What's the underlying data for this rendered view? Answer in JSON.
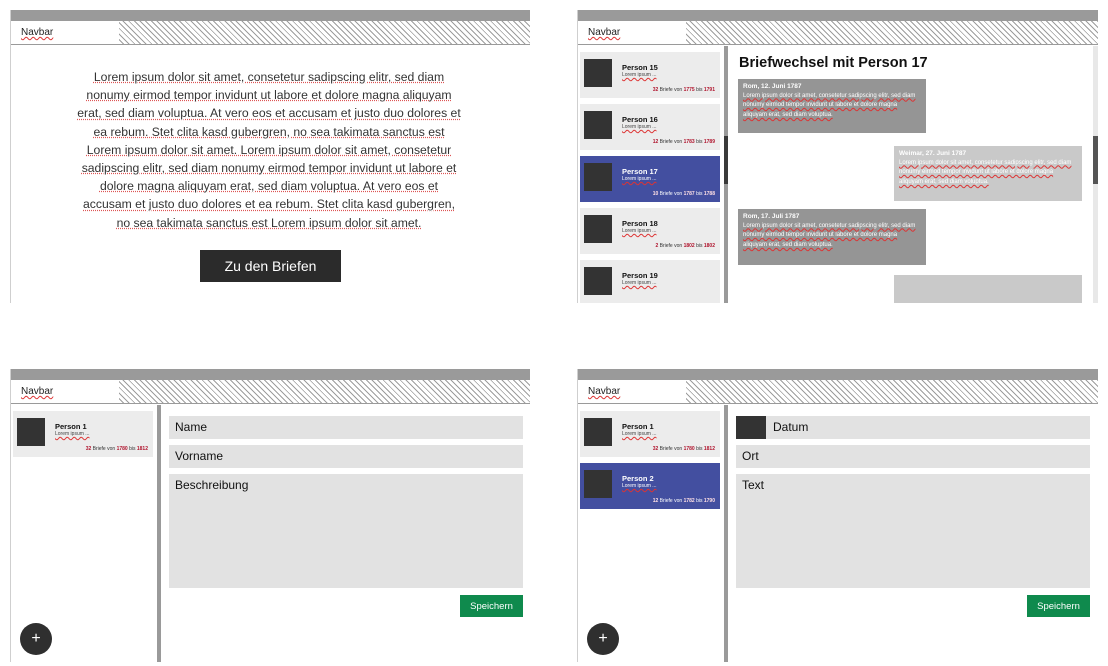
{
  "navbar": {
    "label": "Navbar"
  },
  "landing": {
    "text": "Lorem ipsum dolor sit amet, consetetur sadipscing elitr, sed diam nonumy eirmod tempor invidunt ut labore et dolore magna aliquyam erat, sed diam voluptua. At vero eos et accusam et justo duo dolores et ea rebum. Stet clita kasd gubergren, no sea takimata sanctus est Lorem ipsum dolor sit amet. Lorem ipsum dolor sit amet, consetetur sadipscing elitr, sed diam nonumy eirmod tempor invidunt ut labore et dolore magna aliquyam erat, sed diam voluptua. At vero eos et accusam et justo duo dolores et ea rebum. Stet clita kasd gubergren, no sea takimata sanctus est Lorem ipsum dolor sit amet.",
    "button_label": "Zu den Briefen"
  },
  "correspondence": {
    "persons": [
      {
        "name": "Person 15",
        "sub": "Lorem ipsum ...",
        "count": "32",
        "from": "1775",
        "to": "1791"
      },
      {
        "name": "Person 16",
        "sub": "Lorem ipsum ...",
        "count": "12",
        "from": "1783",
        "to": "1789"
      },
      {
        "name": "Person 17",
        "sub": "Lorem ipsum ...",
        "count": "10",
        "from": "1787",
        "to": "1788"
      },
      {
        "name": "Person 18",
        "sub": "Lorem ipsum ...",
        "count": "2",
        "from": "1802",
        "to": "1802"
      },
      {
        "name": "Person 19",
        "sub": "Lorem ipsum ..."
      }
    ],
    "title": "Briefwechsel mit Person 17",
    "letters": [
      {
        "head": "Rom, 12. Juni 1787",
        "body": "Lorem ipsum dolor sit amet, consetetur sadipscing elitr, sed diam nonumy eirmod tempor invidunt ut labore et dolore magna aliquyam erat, sed diam voluptua."
      },
      {
        "head": "Weimar, 27. Juni 1787",
        "body": "Lorem ipsum dolor sit amet, consetetur sadipscing elitr, sed diam nonumy eirmod tempor invidunt ut labore et dolore magna aliquyam erat, sed diam voluptua."
      },
      {
        "head": "Rom, 17. Juli 1787",
        "body": "Lorem ipsum dolor sit amet, consetetur sadipscing elitr, sed diam nonumy eirmod tempor invidunt ut labore et dolore magna aliquyam erat, sed diam voluptua."
      }
    ]
  },
  "person_form": {
    "persons": [
      {
        "name": "Person 1",
        "sub": "Lorem ipsum ...",
        "count": "32",
        "from": "1780",
        "to": "1812"
      }
    ],
    "field_name": "Name",
    "field_firstname": "Vorname",
    "field_description": "Beschreibung",
    "save_label": "Speichern",
    "add_label": "+"
  },
  "letter_form": {
    "persons": [
      {
        "name": "Person 1",
        "sub": "Lorem ipsum ...",
        "count": "32",
        "from": "1780",
        "to": "1812"
      },
      {
        "name": "Person 2",
        "sub": "Lorem ipsum ...",
        "count": "12",
        "from": "1782",
        "to": "1790"
      }
    ],
    "field_date": "Datum",
    "field_place": "Ort",
    "field_text": "Text",
    "save_label": "Speichern",
    "add_label": "+"
  },
  "labels": {
    "letters_from": "Briefe von",
    "until": "bis"
  },
  "colors": {
    "active_card": "#434fa0",
    "save_button": "#0f8a4d",
    "highlight_year": "#b0152e"
  }
}
